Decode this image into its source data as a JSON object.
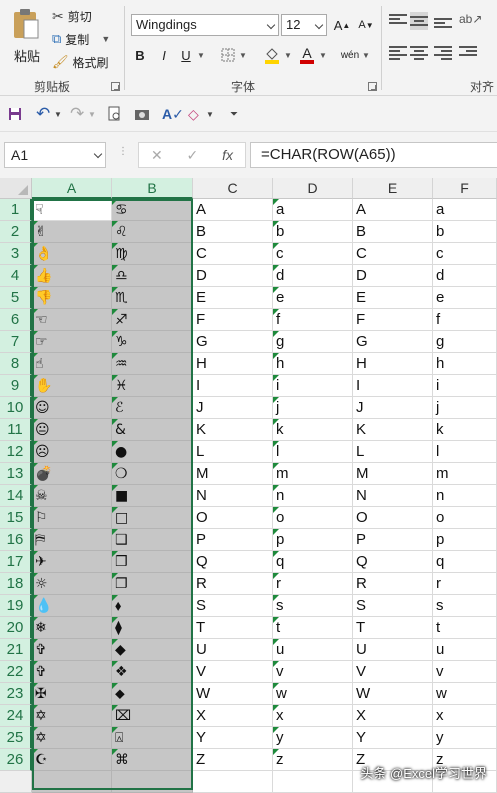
{
  "ribbon": {
    "paste_label": "粘贴",
    "cut_label": "剪切",
    "copy_label": "复制",
    "format_painter_label": "格式刷",
    "clipboard_group": "剪贴板",
    "font_name": "Wingdings",
    "font_size": "12",
    "bold": "B",
    "italic": "I",
    "underline": "U",
    "font_group": "字体",
    "align_group": "对齐方",
    "font_color_glyph": "A",
    "grow_font": "A",
    "shrink_font": "A",
    "phonetic": "wén",
    "accent_colors": {
      "highlight": "#ffd400",
      "font": "#d00000",
      "excel_green": "#217346"
    }
  },
  "quick_access": {
    "icons": [
      "save-icon",
      "undo-icon",
      "redo-icon",
      "print-preview-icon",
      "camera-icon",
      "spelling-icon",
      "eraser-icon",
      "customize-icon"
    ]
  },
  "formula_bar": {
    "name_box": "A1",
    "cancel": "✕",
    "enter": "✓",
    "fx": "fx",
    "formula": "=CHAR(ROW(A65))"
  },
  "sheet": {
    "columns": [
      "A",
      "B",
      "C",
      "D",
      "E",
      "F"
    ],
    "selected_columns": [
      "A",
      "B"
    ],
    "rows": [
      {
        "num": "1",
        "a": "☟",
        "b": "♋",
        "c": "A",
        "d": "a",
        "e": "A",
        "f": "a"
      },
      {
        "num": "2",
        "a": "✌",
        "b": "♌",
        "c": "B",
        "d": "b",
        "e": "B",
        "f": "b"
      },
      {
        "num": "3",
        "a": "👌",
        "b": "♍",
        "c": "C",
        "d": "c",
        "e": "C",
        "f": "c"
      },
      {
        "num": "4",
        "a": "👍",
        "b": "♎",
        "c": "D",
        "d": "d",
        "e": "D",
        "f": "d"
      },
      {
        "num": "5",
        "a": "👎",
        "b": "♏",
        "c": "E",
        "d": "e",
        "e": "E",
        "f": "e"
      },
      {
        "num": "6",
        "a": "☜",
        "b": "♐",
        "c": "F",
        "d": "f",
        "e": "F",
        "f": "f"
      },
      {
        "num": "7",
        "a": "☞",
        "b": "♑",
        "c": "G",
        "d": "g",
        "e": "G",
        "f": "g"
      },
      {
        "num": "8",
        "a": "☝",
        "b": "♒",
        "c": "H",
        "d": "h",
        "e": "H",
        "f": "h"
      },
      {
        "num": "9",
        "a": "✋",
        "b": "♓",
        "c": "I",
        "d": "i",
        "e": "I",
        "f": "i"
      },
      {
        "num": "10",
        "a": "☺",
        "b": "ℰ",
        "c": "J",
        "d": "j",
        "e": "J",
        "f": "j"
      },
      {
        "num": "11",
        "a": "😐",
        "b": "&",
        "c": "K",
        "d": "k",
        "e": "K",
        "f": "k"
      },
      {
        "num": "12",
        "a": "☹",
        "b": "●",
        "c": "L",
        "d": "l",
        "e": "L",
        "f": "l"
      },
      {
        "num": "13",
        "a": "💣",
        "b": "❍",
        "c": "M",
        "d": "m",
        "e": "M",
        "f": "m"
      },
      {
        "num": "14",
        "a": "☠",
        "b": "■",
        "c": "N",
        "d": "n",
        "e": "N",
        "f": "n"
      },
      {
        "num": "15",
        "a": "⚐",
        "b": "□",
        "c": "O",
        "d": "o",
        "e": "O",
        "f": "o"
      },
      {
        "num": "16",
        "a": "⛿",
        "b": "❑",
        "c": "P",
        "d": "p",
        "e": "P",
        "f": "p"
      },
      {
        "num": "17",
        "a": "✈",
        "b": "❒",
        "c": "Q",
        "d": "q",
        "e": "Q",
        "f": "q"
      },
      {
        "num": "18",
        "a": "☼",
        "b": "❐",
        "c": "R",
        "d": "r",
        "e": "R",
        "f": "r"
      },
      {
        "num": "19",
        "a": "💧",
        "b": "⬧",
        "c": "S",
        "d": "s",
        "e": "S",
        "f": "s"
      },
      {
        "num": "20",
        "a": "❄",
        "b": "⧫",
        "c": "T",
        "d": "t",
        "e": "T",
        "f": "t"
      },
      {
        "num": "21",
        "a": "✞",
        "b": "◆",
        "c": "U",
        "d": "u",
        "e": "U",
        "f": "u"
      },
      {
        "num": "22",
        "a": "✞",
        "b": "❖",
        "c": "V",
        "d": "v",
        "e": "V",
        "f": "v"
      },
      {
        "num": "23",
        "a": "✠",
        "b": "⬥",
        "c": "W",
        "d": "w",
        "e": "W",
        "f": "w"
      },
      {
        "num": "24",
        "a": "✡",
        "b": "⌧",
        "c": "X",
        "d": "x",
        "e": "X",
        "f": "x"
      },
      {
        "num": "25",
        "a": "✡",
        "b": "⍓",
        "c": "Y",
        "d": "y",
        "e": "Y",
        "f": "y"
      },
      {
        "num": "26",
        "a": "☪",
        "b": "⌘",
        "c": "Z",
        "d": "z",
        "e": "Z",
        "f": "z"
      },
      {
        "num": "",
        "a": "",
        "b": "",
        "c": "",
        "d": "",
        "e": "",
        "f": ""
      }
    ]
  },
  "watermark": "头条 @Excel学习世界"
}
